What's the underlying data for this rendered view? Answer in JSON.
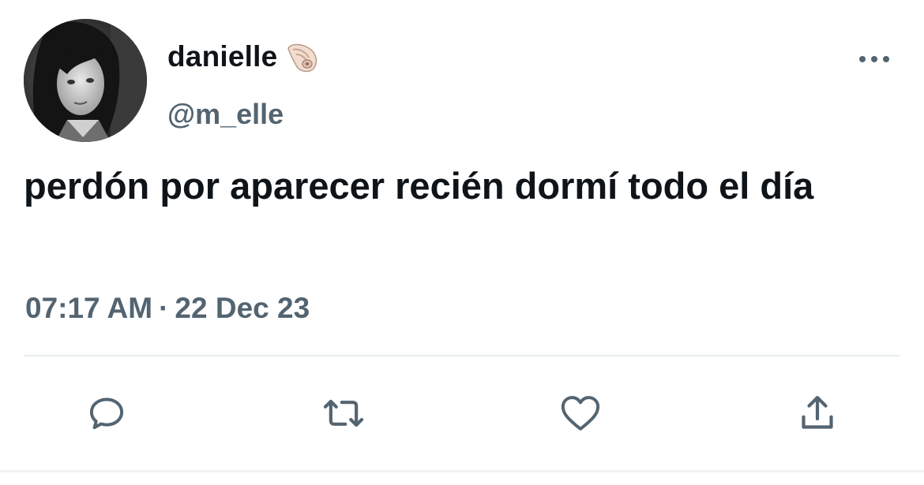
{
  "tweet": {
    "author": {
      "display_name": "danielle",
      "name_emoji_icon": "spiral-shell-icon",
      "handle": "@m_elle",
      "avatar": "profile-photo"
    },
    "text": "perdón por aparecer recién dormí todo el día",
    "time": "07:17 AM",
    "separator": "·",
    "date": "22 Dec 23",
    "actions": [
      {
        "name": "reply",
        "icon": "speech-bubble-icon"
      },
      {
        "name": "retweet",
        "icon": "retweet-arrows-icon"
      },
      {
        "name": "like",
        "icon": "heart-icon"
      },
      {
        "name": "share",
        "icon": "share-upload-icon"
      }
    ],
    "more_icon": "more-dots-icon",
    "colors": {
      "primary_text": "#0f1419",
      "secondary_text": "#536471",
      "divider": "#e6ecf0"
    }
  }
}
